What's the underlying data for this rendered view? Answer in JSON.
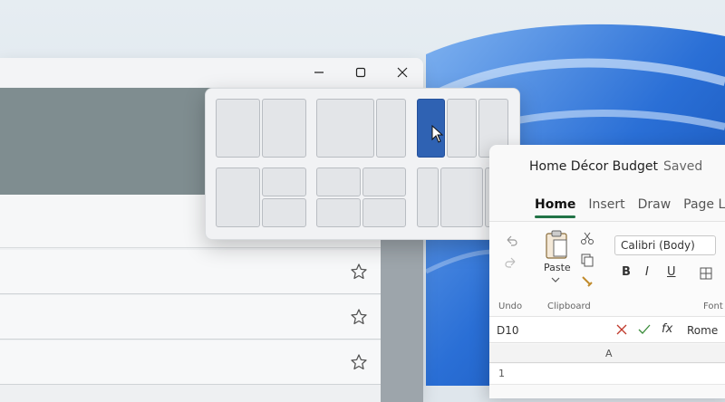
{
  "explorer_window": {
    "minimize_icon": "minimize-icon",
    "maximize_icon": "maximize-icon",
    "close_icon": "close-icon",
    "rows": [
      {
        "star_icon": "star-outline-icon"
      },
      {
        "star_icon": "star-outline-icon"
      },
      {
        "star_icon": "star-outline-icon"
      }
    ]
  },
  "snap_layouts": {
    "highlight_color": "#2f62b3",
    "cursor_icon": "mouse-pointer-icon"
  },
  "excel": {
    "doc_title": "Home Décor Budget",
    "status": "Saved",
    "tabs": [
      "Home",
      "Insert",
      "Draw",
      "Page Lay"
    ],
    "active_tab": "Home",
    "ribbon": {
      "paste_label": "Paste",
      "undo_label": "Undo",
      "clipboard_label": "Clipboard",
      "font_group_label": "Font",
      "font_name": "Calibri (Body)",
      "bold": "B",
      "italic": "I",
      "underline": "U"
    },
    "name_box": "D10",
    "fx_label": "fx",
    "formula_value": "Rome",
    "column_header": "A",
    "row_number": "1",
    "accent_color": "#217346"
  }
}
